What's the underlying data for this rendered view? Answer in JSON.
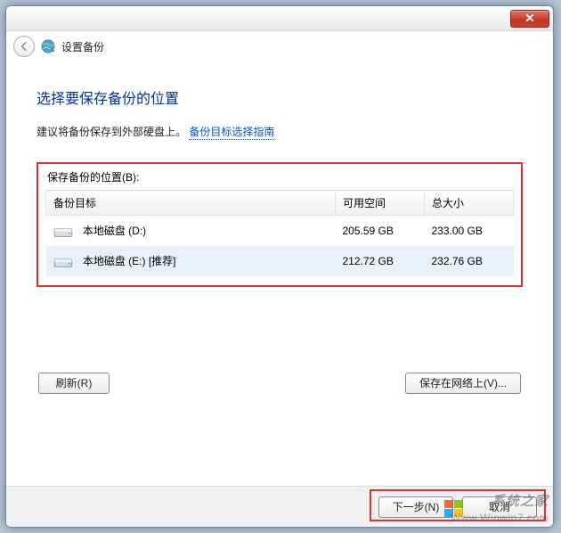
{
  "titlebar": {
    "close_glyph": "✕"
  },
  "nav": {
    "title": "设置备份"
  },
  "main": {
    "heading": "选择要保存备份的位置",
    "recommend_text": "建议将备份保存到外部硬盘上。",
    "guide_link": "备份目标选择指南"
  },
  "section": {
    "label": "保存备份的位置(B):",
    "columns": {
      "target": "备份目标",
      "free": "可用空间",
      "total": "总大小"
    },
    "rows": [
      {
        "name": "本地磁盘 (D:)",
        "free": "205.59 GB",
        "total": "233.00 GB"
      },
      {
        "name": "本地磁盘 (E:) [推荐]",
        "free": "212.72 GB",
        "total": "232.76 GB"
      }
    ]
  },
  "buttons": {
    "refresh": "刷新(R)",
    "network": "保存在网络上(V)...",
    "next": "下一步(N)",
    "cancel": "取消"
  },
  "watermark": {
    "text": "系统之家",
    "url": "Www.Winwin7.com"
  }
}
